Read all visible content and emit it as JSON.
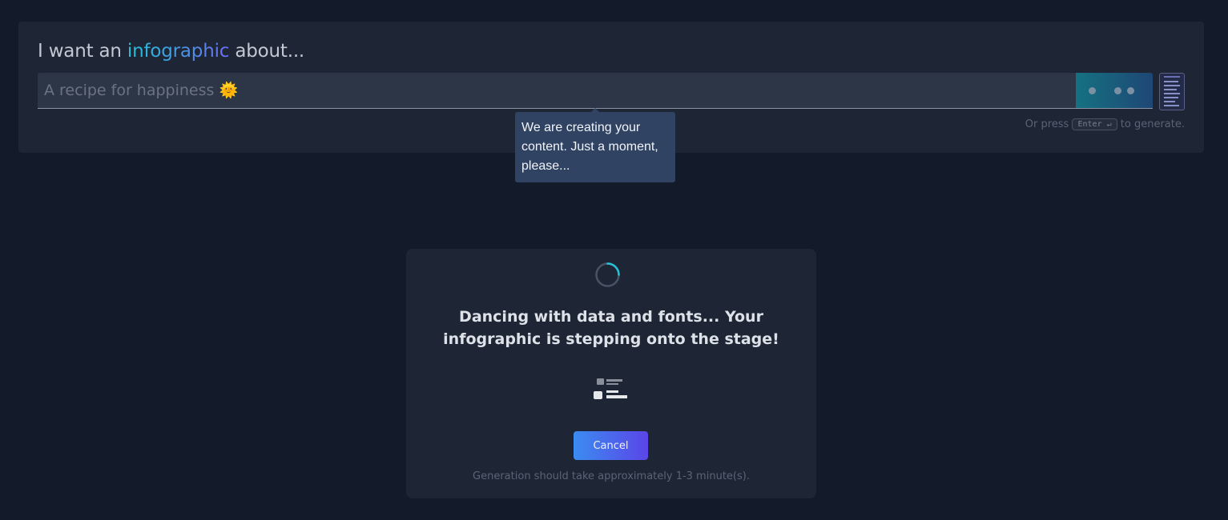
{
  "header": {
    "prefix": "I want an",
    "accent": "infographic",
    "suffix": "about..."
  },
  "input": {
    "placeholder": "A recipe for happiness 🌞",
    "value": ""
  },
  "hint": {
    "before": "Or press",
    "key": "Enter ↵",
    "after": "to generate."
  },
  "tooltip": {
    "text": "We are creating your content. Just a moment, please..."
  },
  "loading": {
    "message": "Dancing with data and fonts... Your infographic is stepping onto the stage!",
    "cancel_label": "Cancel",
    "eta": "Generation should take approximately 1-3 minute(s)."
  },
  "icons": {
    "spinner": "spinner-icon",
    "infographic": "infographic-layout-icon",
    "generate": "loading-dots-icon",
    "template": "template-thumbnail-icon"
  },
  "colors": {
    "background": "#131a2a",
    "panel": "#1e2635",
    "accent_start": "#22c3d6",
    "accent_end": "#6a6ef0",
    "tooltip": "#314363",
    "button_start": "#3b8cf0",
    "button_end": "#5b45e8"
  }
}
